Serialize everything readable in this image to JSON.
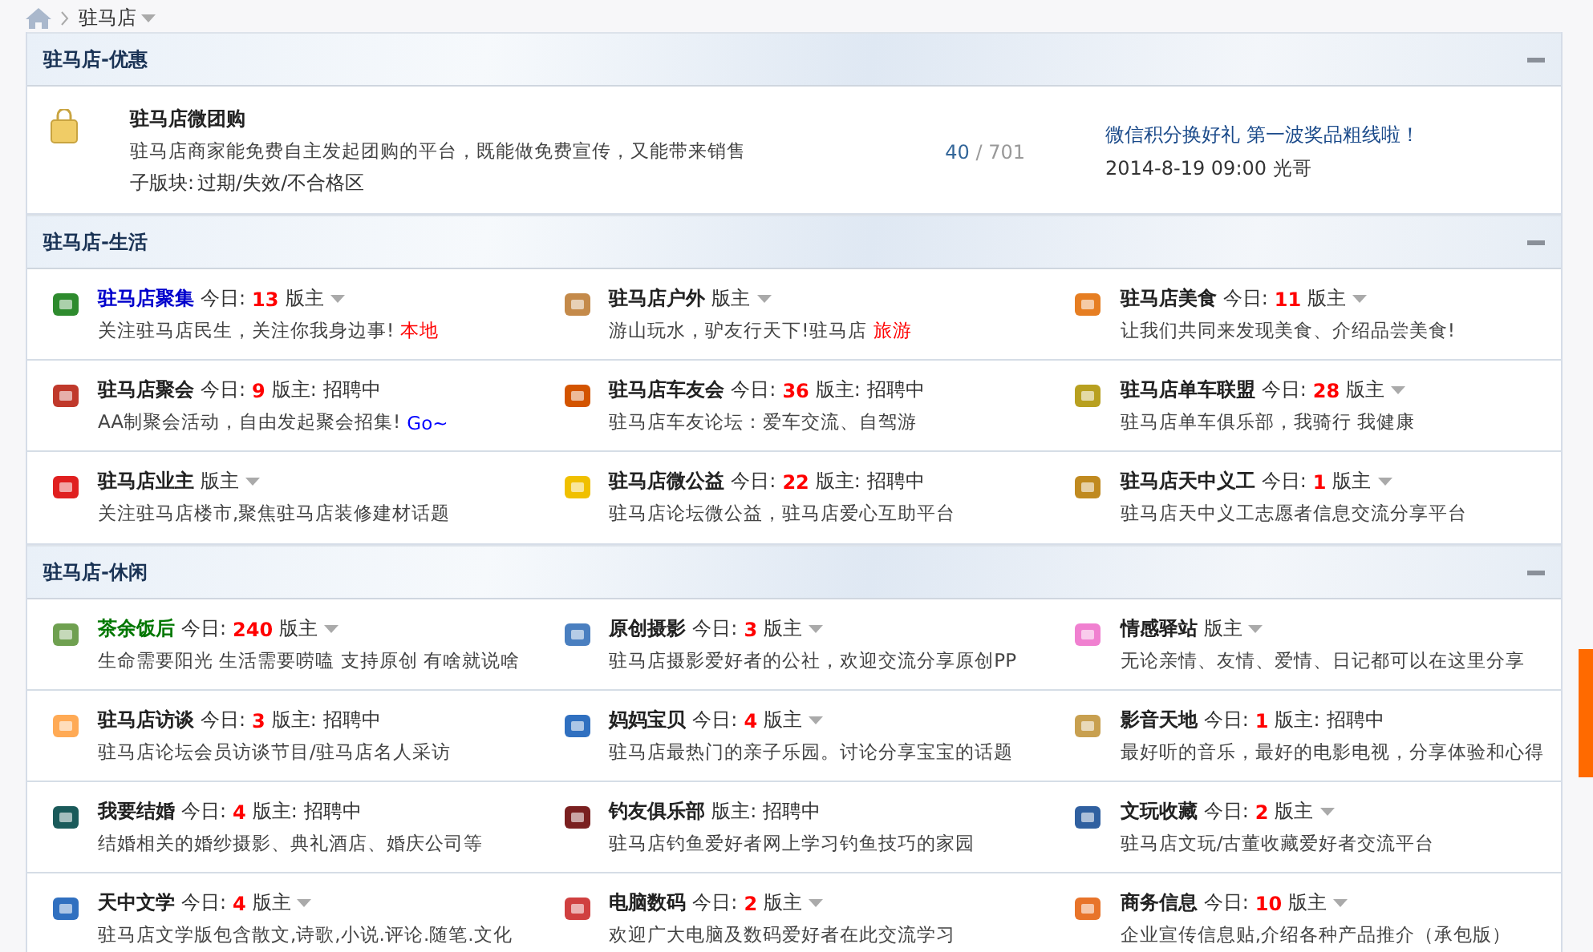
{
  "breadcrumb": {
    "current": "驻马店"
  },
  "sections": [
    {
      "title": "驻马店-优惠",
      "collapsed": false,
      "kind": "list",
      "items": [
        {
          "name": "驻马店微团购",
          "desc": "驻马店商家能免费自主发起团购的平台，既能做免费宣传，又能带来销售",
          "sub_label": "子版块:",
          "subs": "过期/失效/不合格区",
          "threads": "40",
          "posts": "/ 701",
          "last_title": "微信积分换好礼 第一波奖品粗线啦！",
          "last_time": "2014-8-19 09:00",
          "last_user": "光哥"
        }
      ]
    },
    {
      "title": "驻马店-生活",
      "collapsed": false,
      "kind": "grid",
      "items": [
        {
          "name": "驻马店聚集",
          "color": "#0000cc",
          "today_label": "今日:",
          "today": "13",
          "mod_label": "版主",
          "desc": "关注驻马店民生，关注你我身边事!",
          "tag": {
            "text": "本地",
            "color": "#ff0000"
          }
        },
        {
          "name": "驻马店户外",
          "color": "#222222",
          "mod_label": "版主",
          "desc": "游山玩水，驴友行天下!驻马店",
          "tag": {
            "text": "旅游",
            "color": "#ff0000"
          }
        },
        {
          "name": "驻马店美食",
          "color": "#222222",
          "today_label": "今日:",
          "today": "11",
          "mod_label": "版主",
          "desc": "让我们共同来发现美食、介绍品尝美食!"
        },
        {
          "name": "驻马店聚会",
          "color": "#222222",
          "today_label": "今日:",
          "today": "9",
          "mod_label": "版主:",
          "mod": "招聘中",
          "desc": "AA制聚会活动，自由发起聚会招集!",
          "tag": {
            "text": "Go~",
            "color": "#0000ff"
          }
        },
        {
          "name": "驻马店车友会",
          "color": "#222222",
          "today_label": "今日:",
          "today": "36",
          "mod_label": "版主:",
          "mod": "招聘中",
          "desc": "驻马店车友论坛：爱车交流、自驾游"
        },
        {
          "name": "驻马店单车联盟",
          "color": "#222222",
          "today_label": "今日:",
          "today": "28",
          "mod_label": "版主",
          "desc": "驻马店单车俱乐部，我骑行 我健康"
        },
        {
          "name": "驻马店业主",
          "color": "#222222",
          "mod_label": "版主",
          "desc": "关注驻马店楼市,聚焦驻马店装修建材话题"
        },
        {
          "name": "驻马店微公益",
          "color": "#222222",
          "today_label": "今日:",
          "today": "22",
          "mod_label": "版主:",
          "mod": "招聘中",
          "desc": "驻马店论坛微公益，驻马店爱心互助平台"
        },
        {
          "name": "驻马店天中义工",
          "color": "#222222",
          "today_label": "今日:",
          "today": "1",
          "mod_label": "版主",
          "desc": "驻马店天中义工志愿者信息交流分享平台"
        }
      ]
    },
    {
      "title": "驻马店-休闲",
      "collapsed": false,
      "kind": "grid",
      "items": [
        {
          "name": "茶余饭后",
          "color": "#007700",
          "today_label": "今日:",
          "today": "240",
          "mod_label": "版主",
          "desc": "生命需要阳光 生活需要唠嗑 支持原创 有啥就说啥"
        },
        {
          "name": "原创摄影",
          "color": "#222222",
          "today_label": "今日:",
          "today": "3",
          "mod_label": "版主",
          "desc": "驻马店摄影爱好者的公社，欢迎交流分享原创PP"
        },
        {
          "name": "情感驿站",
          "color": "#222222",
          "mod_label": "版主",
          "desc": "无论亲情、友情、爱情、日记都可以在这里分享"
        },
        {
          "name": "驻马店访谈",
          "color": "#222222",
          "today_label": "今日:",
          "today": "3",
          "mod_label": "版主:",
          "mod": "招聘中",
          "desc": "驻马店论坛会员访谈节目/驻马店名人采访"
        },
        {
          "name": "妈妈宝贝",
          "color": "#222222",
          "today_label": "今日:",
          "today": "4",
          "mod_label": "版主",
          "desc": "驻马店最热门的亲子乐园。讨论分享宝宝的话题"
        },
        {
          "name": "影音天地",
          "color": "#222222",
          "today_label": "今日:",
          "today": "1",
          "mod_label": "版主:",
          "mod": "招聘中",
          "desc": "最好听的音乐，最好的电影电视，分享体验和心得"
        },
        {
          "name": "我要结婚",
          "color": "#222222",
          "today_label": "今日:",
          "today": "4",
          "mod_label": "版主:",
          "mod": "招聘中",
          "desc": "结婚相关的婚纱摄影、典礼酒店、婚庆公司等"
        },
        {
          "name": "钓友俱乐部",
          "color": "#222222",
          "mod_label": "版主:",
          "mod": "招聘中",
          "desc": "驻马店钓鱼爱好者网上学习钓鱼技巧的家园"
        },
        {
          "name": "文玩收藏",
          "color": "#222222",
          "today_label": "今日:",
          "today": "2",
          "mod_label": "版主",
          "desc": "驻马店文玩/古董收藏爱好者交流平台"
        },
        {
          "name": "天中文学",
          "color": "#222222",
          "today_label": "今日:",
          "today": "4",
          "mod_label": "版主",
          "desc": "驻马店文学版包含散文,诗歌,小说.评论.随笔.文化"
        },
        {
          "name": "电脑数码",
          "color": "#222222",
          "today_label": "今日:",
          "today": "2",
          "mod_label": "版主",
          "desc": "欢迎广大电脑及数码爱好者在此交流学习"
        },
        {
          "name": "商务信息",
          "color": "#222222",
          "today_label": "今日:",
          "today": "10",
          "mod_label": "版主",
          "desc": "企业宣传信息贴,介绍各种产品推介（承包版）"
        }
      ]
    }
  ]
}
